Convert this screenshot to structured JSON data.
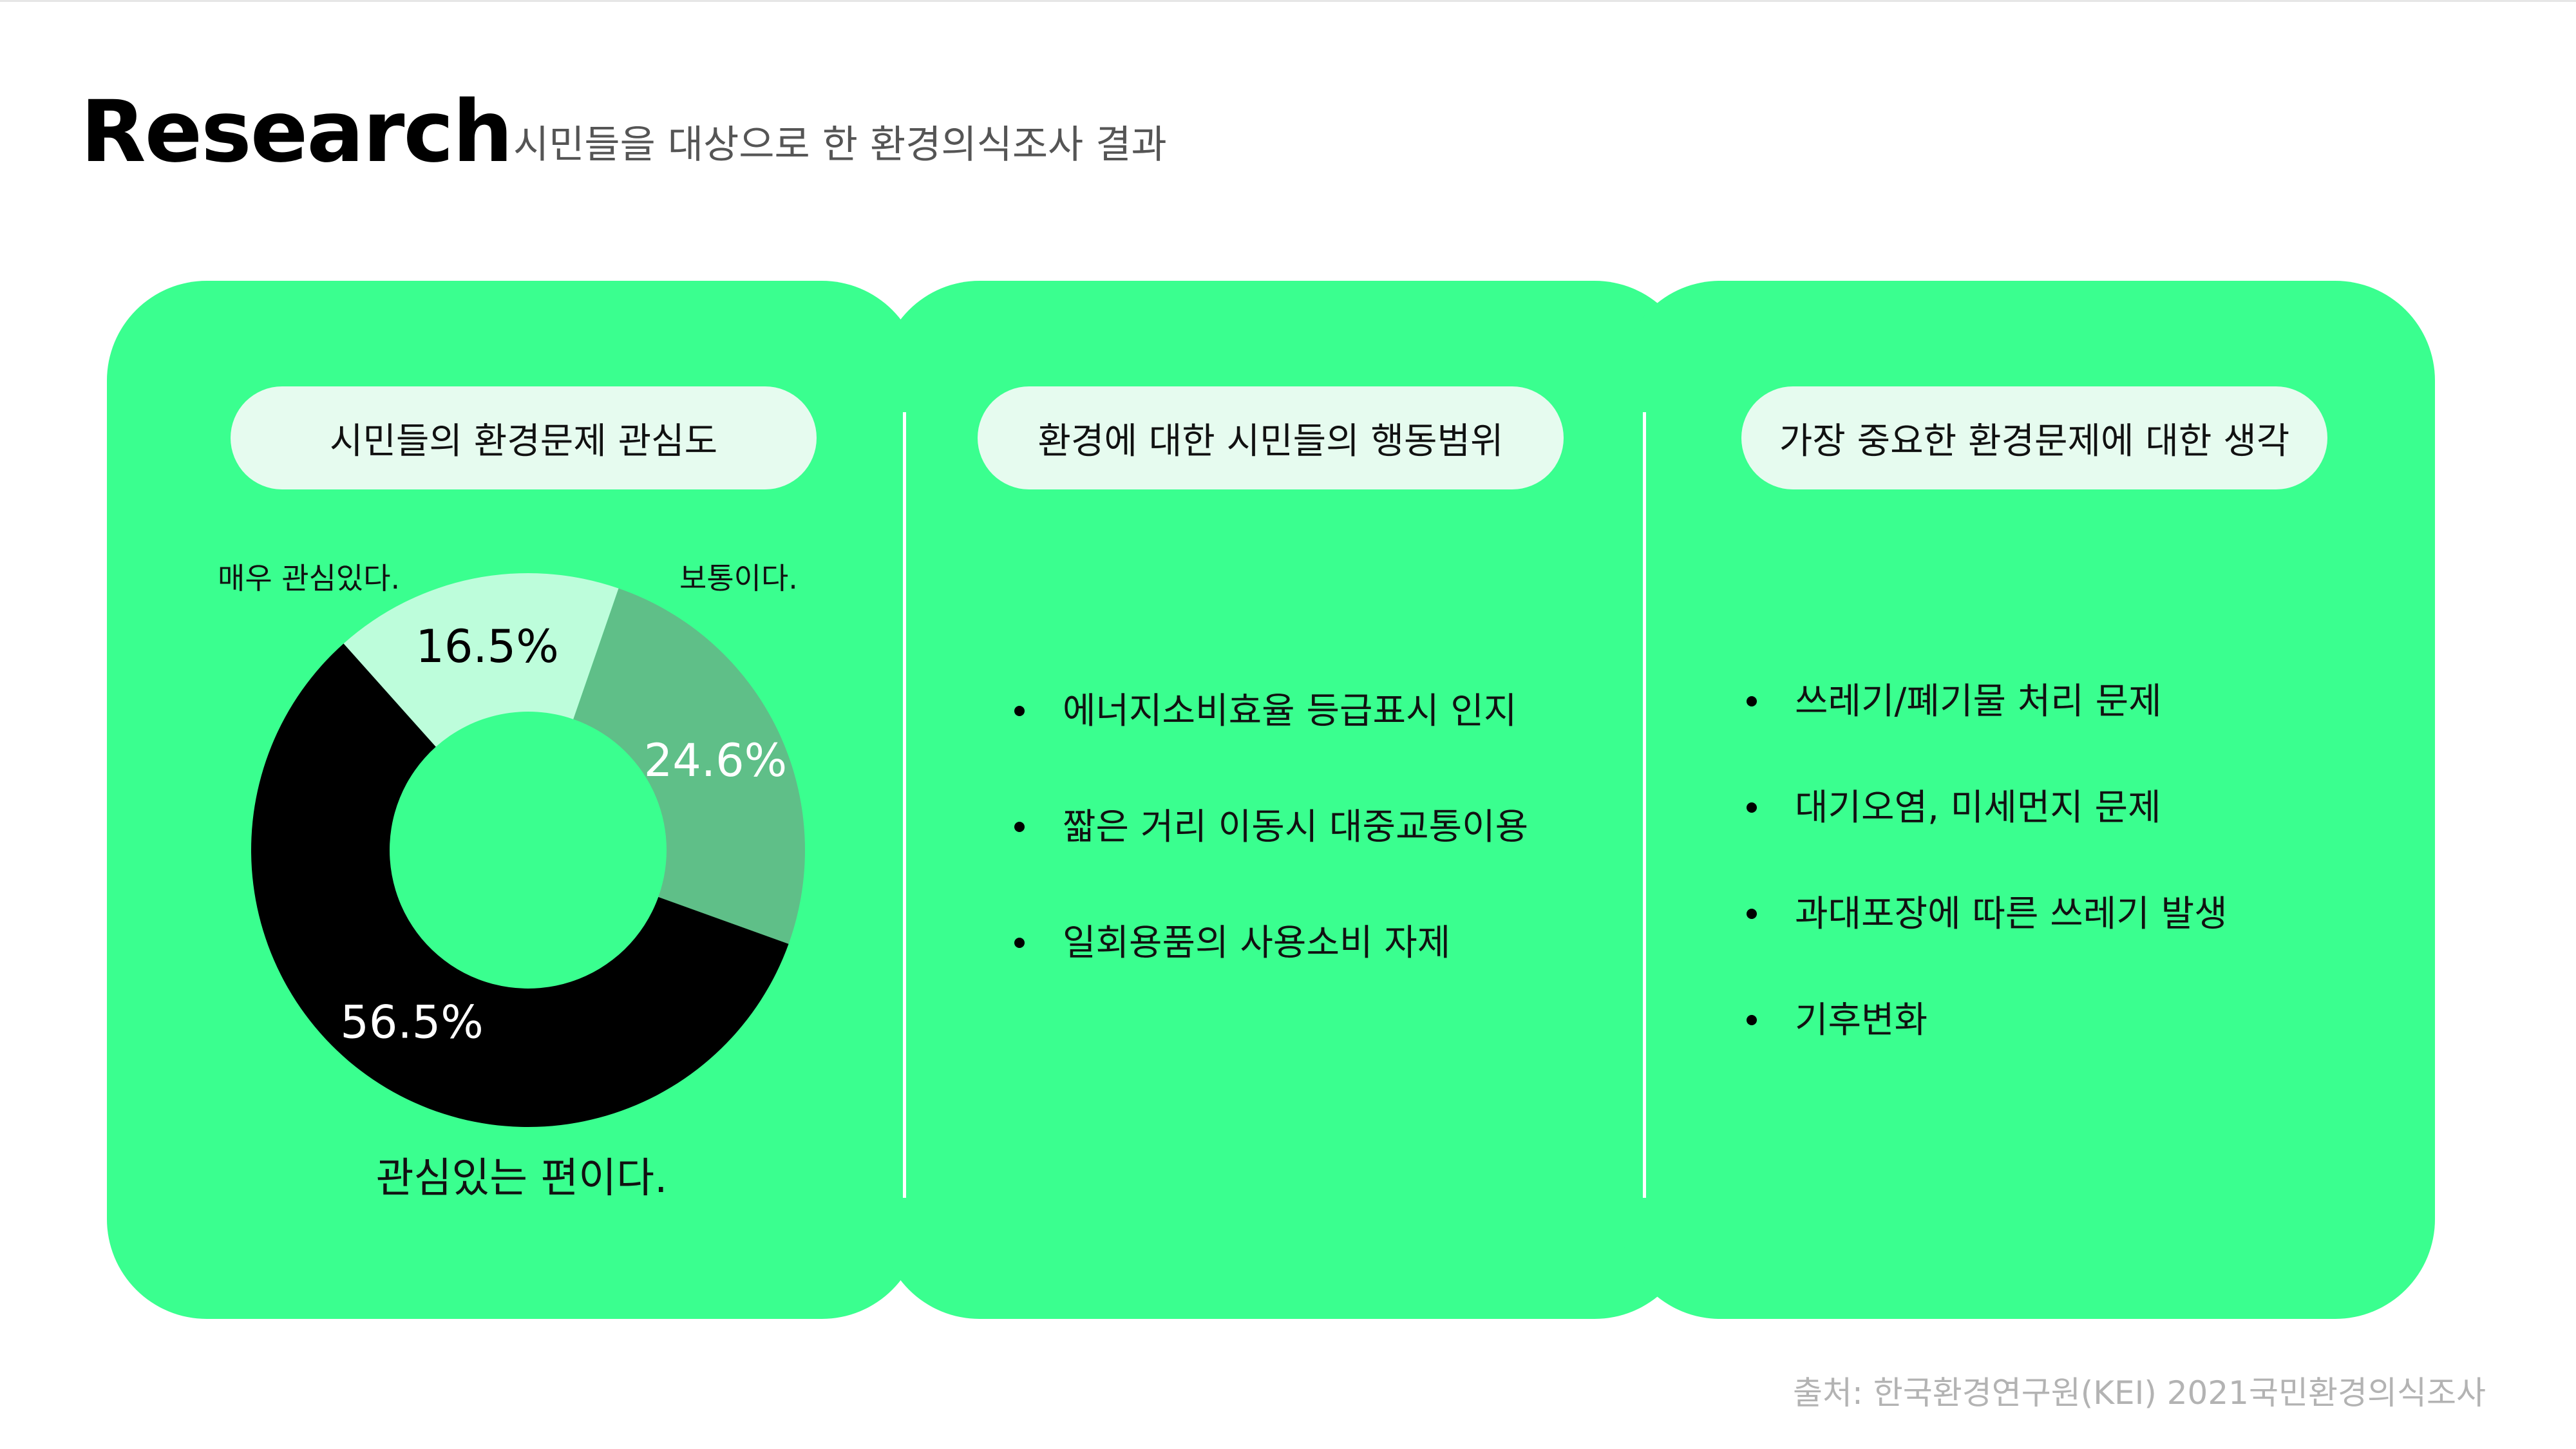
{
  "header": {
    "title": "Research",
    "subtitle": "시민들을 대상으로 한 환경의식조사 결과"
  },
  "colors": {
    "card": "#3aff8f",
    "pill": "#e6fbef",
    "very_interested": "#bdfddb",
    "normal": "#5fbf88",
    "interested": "#000000"
  },
  "panel1": {
    "title": "시민들의 환경문제 관심도",
    "label_very": "매우 관심있다.",
    "label_normal": "보통이다.",
    "label_interested": "관심있는 편이다."
  },
  "panel2": {
    "title": "환경에 대한 시민들의 행동범위",
    "items": [
      "에너지소비효율 등급표시 인지",
      "짧은 거리 이동시 대중교통이용",
      "일회용품의 사용소비 자제"
    ]
  },
  "panel3": {
    "title": "가장 중요한 환경문제에 대한 생각",
    "items": [
      "쓰레기/폐기물 처리 문제",
      "대기오염, 미세먼지 문제",
      "과대포장에 따른 쓰레기 발생",
      "기후변화"
    ]
  },
  "chart_data": {
    "type": "pie",
    "donut": true,
    "title": "시민들의 환경문제 관심도",
    "slices": [
      {
        "label": "매우 관심있다.",
        "value": 16.5,
        "display": "16.5%",
        "color": "#bdfddb",
        "text_color": "#000000"
      },
      {
        "label": "보통이다.",
        "value": 24.6,
        "display": "24.6%",
        "color": "#5fbf88",
        "text_color": "#ffffff"
      },
      {
        "label": "관심있는 편이다.",
        "value": 56.5,
        "display": "56.5%",
        "color": "#000000",
        "text_color": "#ffffff"
      }
    ]
  },
  "footer": {
    "source": "출처: 한국환경연구원(KEI) 2021국민환경의식조사"
  }
}
